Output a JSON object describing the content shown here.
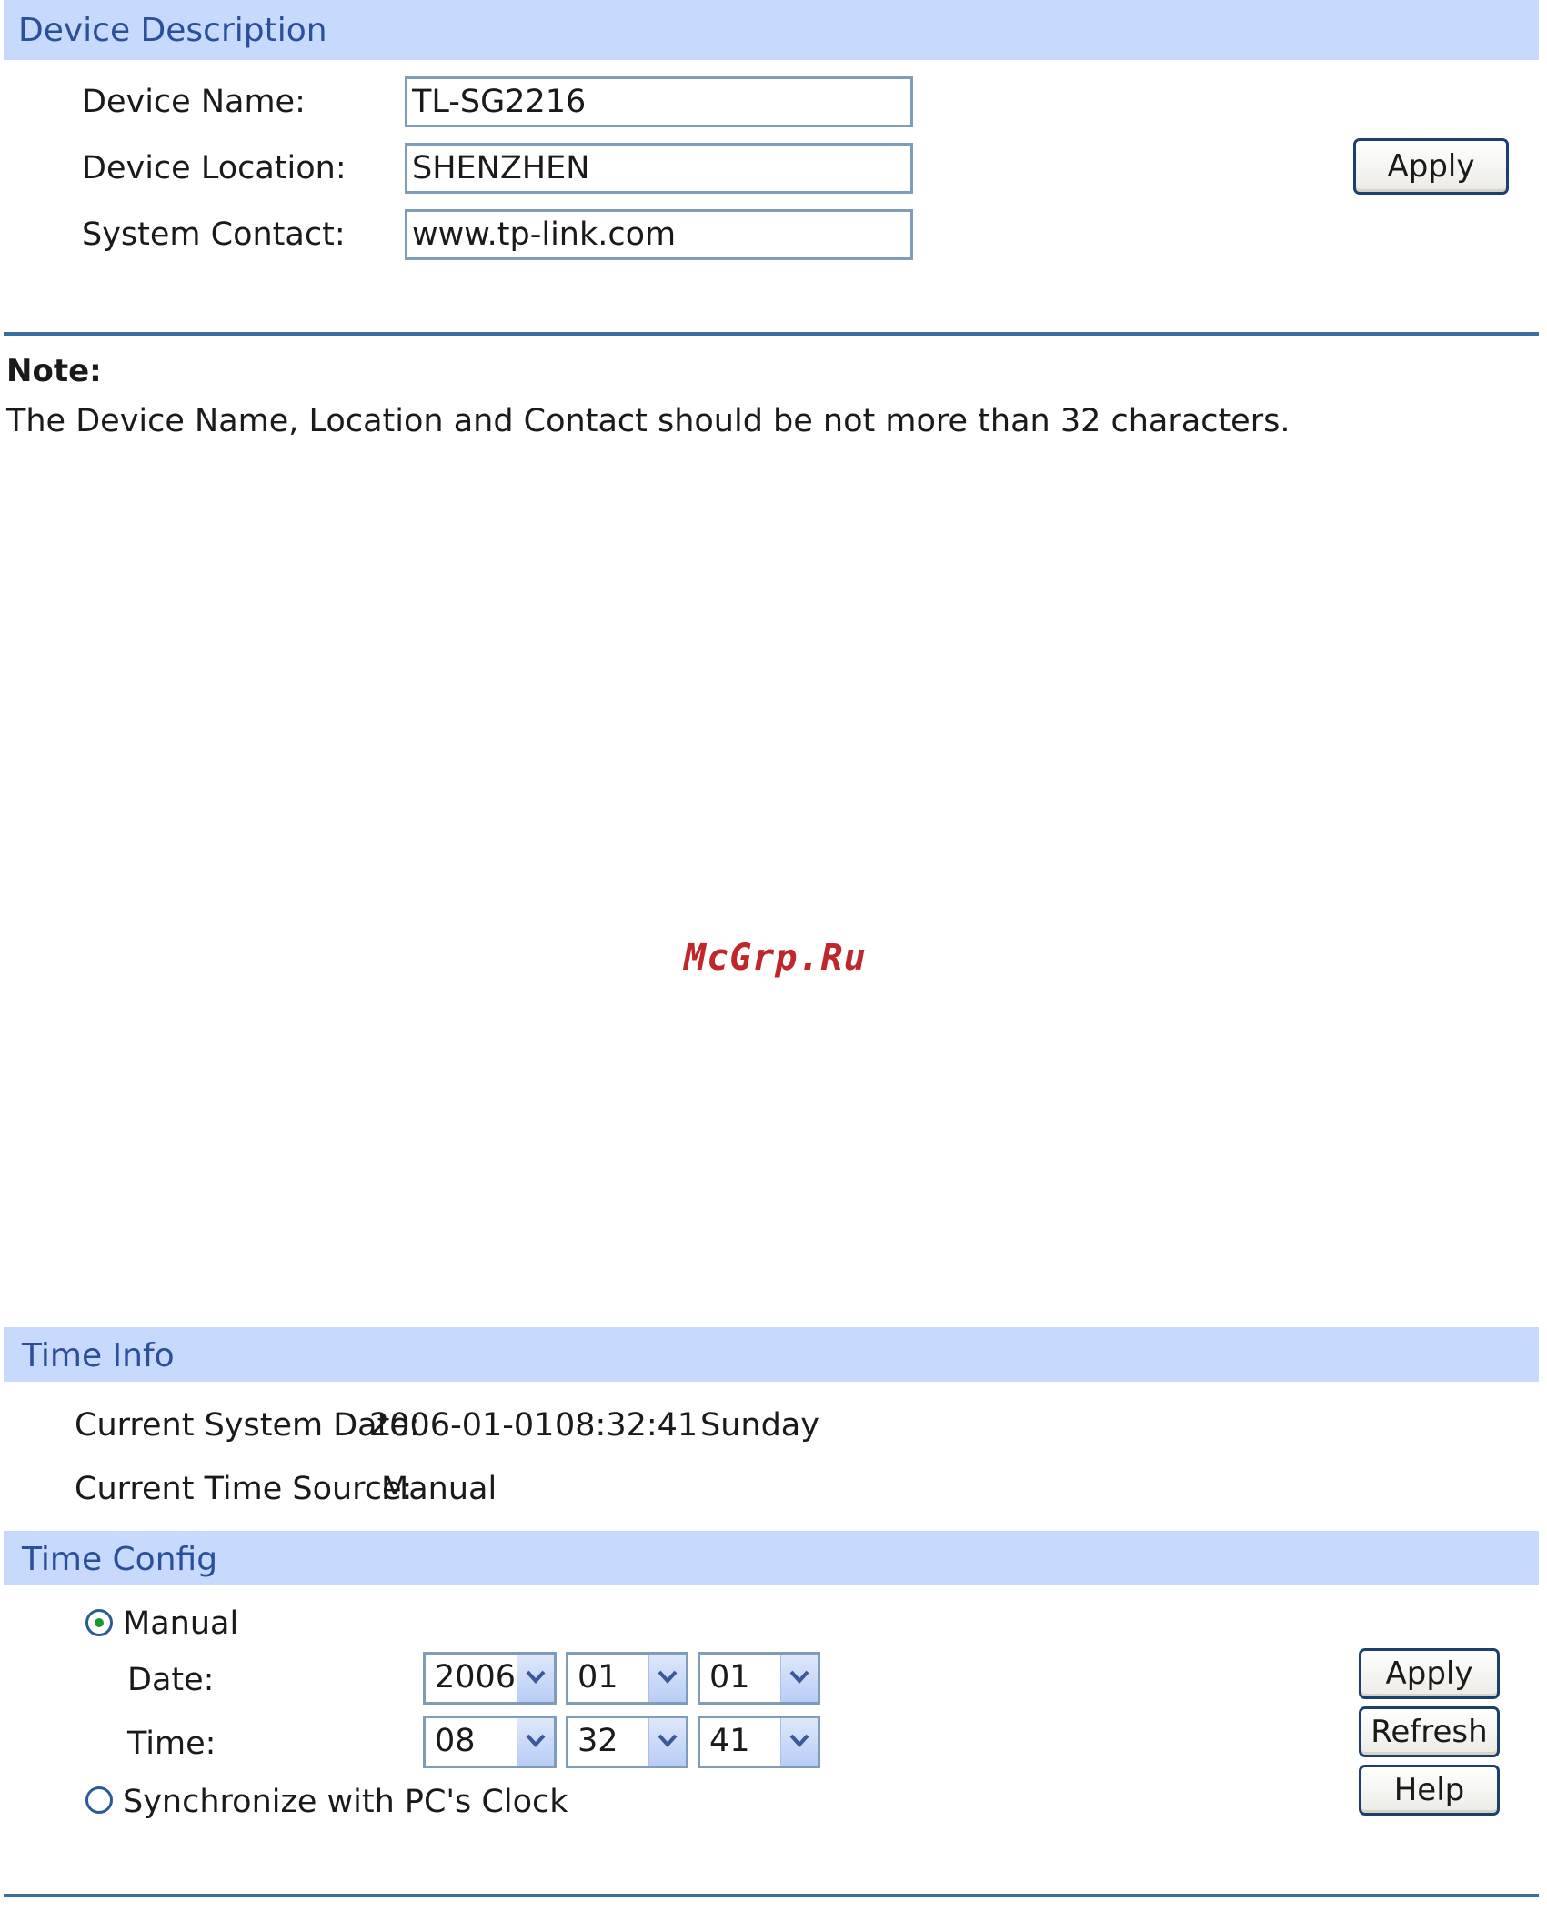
{
  "device_description": {
    "title": "Device Description",
    "device_name_label": "Device Name:",
    "device_name_value": "TL-SG2216",
    "device_location_label": "Device Location:",
    "device_location_value": "SHENZHEN",
    "system_contact_label": "System Contact:",
    "system_contact_value": "www.tp-link.com",
    "apply_label": "Apply"
  },
  "note": {
    "heading": "Note:",
    "text": "The Device Name, Location and Contact should be not more than 32 characters."
  },
  "watermark": "McGrp.Ru",
  "time_info": {
    "title": "Time Info",
    "current_system_date_label": "Current System Date:",
    "date": "2006-01-01",
    "time": "08:32:41",
    "weekday": "Sunday",
    "current_time_source_label": "Current Time Source:",
    "time_source": "Manual"
  },
  "time_config": {
    "title": "Time Config",
    "manual_label": "Manual",
    "manual_selected": true,
    "date_label": "Date:",
    "date_year": "2006",
    "date_month": "01",
    "date_day": "01",
    "time_label": "Time:",
    "time_hour": "08",
    "time_minute": "32",
    "time_second": "41",
    "sync_label": "Synchronize with PC's Clock",
    "sync_selected": false,
    "apply_label": "Apply",
    "refresh_label": "Refresh",
    "help_label": "Help"
  }
}
